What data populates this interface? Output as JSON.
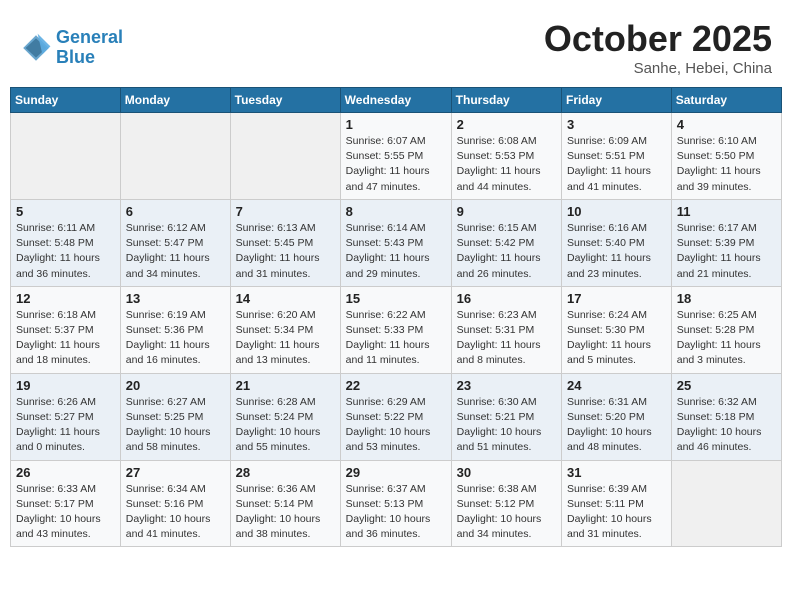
{
  "header": {
    "logo_line1": "General",
    "logo_line2": "Blue",
    "month": "October 2025",
    "location": "Sanhe, Hebei, China"
  },
  "weekdays": [
    "Sunday",
    "Monday",
    "Tuesday",
    "Wednesday",
    "Thursday",
    "Friday",
    "Saturday"
  ],
  "weeks": [
    [
      {
        "day": "",
        "info": ""
      },
      {
        "day": "",
        "info": ""
      },
      {
        "day": "",
        "info": ""
      },
      {
        "day": "1",
        "info": "Sunrise: 6:07 AM\nSunset: 5:55 PM\nDaylight: 11 hours and 47 minutes."
      },
      {
        "day": "2",
        "info": "Sunrise: 6:08 AM\nSunset: 5:53 PM\nDaylight: 11 hours and 44 minutes."
      },
      {
        "day": "3",
        "info": "Sunrise: 6:09 AM\nSunset: 5:51 PM\nDaylight: 11 hours and 41 minutes."
      },
      {
        "day": "4",
        "info": "Sunrise: 6:10 AM\nSunset: 5:50 PM\nDaylight: 11 hours and 39 minutes."
      }
    ],
    [
      {
        "day": "5",
        "info": "Sunrise: 6:11 AM\nSunset: 5:48 PM\nDaylight: 11 hours and 36 minutes."
      },
      {
        "day": "6",
        "info": "Sunrise: 6:12 AM\nSunset: 5:47 PM\nDaylight: 11 hours and 34 minutes."
      },
      {
        "day": "7",
        "info": "Sunrise: 6:13 AM\nSunset: 5:45 PM\nDaylight: 11 hours and 31 minutes."
      },
      {
        "day": "8",
        "info": "Sunrise: 6:14 AM\nSunset: 5:43 PM\nDaylight: 11 hours and 29 minutes."
      },
      {
        "day": "9",
        "info": "Sunrise: 6:15 AM\nSunset: 5:42 PM\nDaylight: 11 hours and 26 minutes."
      },
      {
        "day": "10",
        "info": "Sunrise: 6:16 AM\nSunset: 5:40 PM\nDaylight: 11 hours and 23 minutes."
      },
      {
        "day": "11",
        "info": "Sunrise: 6:17 AM\nSunset: 5:39 PM\nDaylight: 11 hours and 21 minutes."
      }
    ],
    [
      {
        "day": "12",
        "info": "Sunrise: 6:18 AM\nSunset: 5:37 PM\nDaylight: 11 hours and 18 minutes."
      },
      {
        "day": "13",
        "info": "Sunrise: 6:19 AM\nSunset: 5:36 PM\nDaylight: 11 hours and 16 minutes."
      },
      {
        "day": "14",
        "info": "Sunrise: 6:20 AM\nSunset: 5:34 PM\nDaylight: 11 hours and 13 minutes."
      },
      {
        "day": "15",
        "info": "Sunrise: 6:22 AM\nSunset: 5:33 PM\nDaylight: 11 hours and 11 minutes."
      },
      {
        "day": "16",
        "info": "Sunrise: 6:23 AM\nSunset: 5:31 PM\nDaylight: 11 hours and 8 minutes."
      },
      {
        "day": "17",
        "info": "Sunrise: 6:24 AM\nSunset: 5:30 PM\nDaylight: 11 hours and 5 minutes."
      },
      {
        "day": "18",
        "info": "Sunrise: 6:25 AM\nSunset: 5:28 PM\nDaylight: 11 hours and 3 minutes."
      }
    ],
    [
      {
        "day": "19",
        "info": "Sunrise: 6:26 AM\nSunset: 5:27 PM\nDaylight: 11 hours and 0 minutes."
      },
      {
        "day": "20",
        "info": "Sunrise: 6:27 AM\nSunset: 5:25 PM\nDaylight: 10 hours and 58 minutes."
      },
      {
        "day": "21",
        "info": "Sunrise: 6:28 AM\nSunset: 5:24 PM\nDaylight: 10 hours and 55 minutes."
      },
      {
        "day": "22",
        "info": "Sunrise: 6:29 AM\nSunset: 5:22 PM\nDaylight: 10 hours and 53 minutes."
      },
      {
        "day": "23",
        "info": "Sunrise: 6:30 AM\nSunset: 5:21 PM\nDaylight: 10 hours and 51 minutes."
      },
      {
        "day": "24",
        "info": "Sunrise: 6:31 AM\nSunset: 5:20 PM\nDaylight: 10 hours and 48 minutes."
      },
      {
        "day": "25",
        "info": "Sunrise: 6:32 AM\nSunset: 5:18 PM\nDaylight: 10 hours and 46 minutes."
      }
    ],
    [
      {
        "day": "26",
        "info": "Sunrise: 6:33 AM\nSunset: 5:17 PM\nDaylight: 10 hours and 43 minutes."
      },
      {
        "day": "27",
        "info": "Sunrise: 6:34 AM\nSunset: 5:16 PM\nDaylight: 10 hours and 41 minutes."
      },
      {
        "day": "28",
        "info": "Sunrise: 6:36 AM\nSunset: 5:14 PM\nDaylight: 10 hours and 38 minutes."
      },
      {
        "day": "29",
        "info": "Sunrise: 6:37 AM\nSunset: 5:13 PM\nDaylight: 10 hours and 36 minutes."
      },
      {
        "day": "30",
        "info": "Sunrise: 6:38 AM\nSunset: 5:12 PM\nDaylight: 10 hours and 34 minutes."
      },
      {
        "day": "31",
        "info": "Sunrise: 6:39 AM\nSunset: 5:11 PM\nDaylight: 10 hours and 31 minutes."
      },
      {
        "day": "",
        "info": ""
      }
    ]
  ]
}
